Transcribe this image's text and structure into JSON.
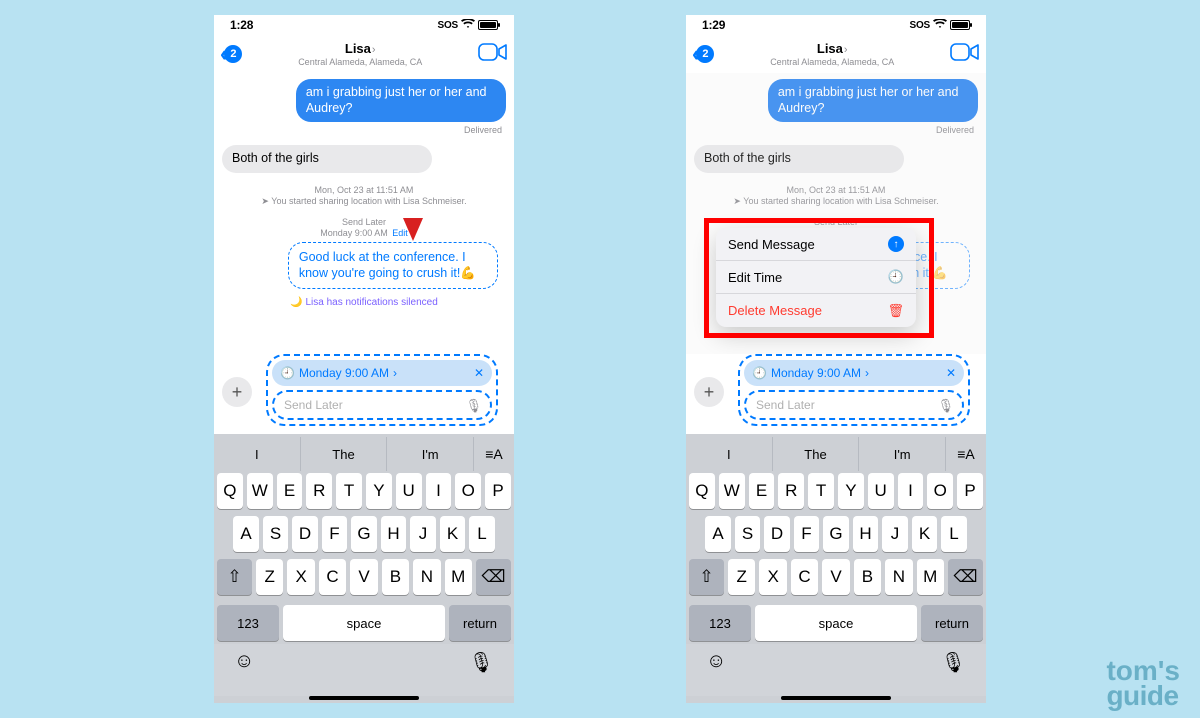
{
  "statusbar": {
    "time_left": "1:28",
    "time_right": "1:29",
    "sos": "SOS"
  },
  "nav": {
    "back_badge": "2",
    "title": "Lisa",
    "subtitle": "Central Alameda, Alameda, CA"
  },
  "conv": {
    "outgoing_msg": "am i grabbing just her or her and Audrey?",
    "delivered": "Delivered",
    "incoming_msg": "Both of the girls",
    "timestamp1": "Mon, Oct 23 at 11:51 AM",
    "location_share": "You started sharing location with Lisa Schmeiser.",
    "send_later_header": "Send Later",
    "schedule_line": "Monday 9:00 AM",
    "edit_link": "Edit",
    "scheduled_msg": "Good luck at the conference. I know you're going to crush it!💪",
    "silenced": "Lisa has notifications silenced"
  },
  "input": {
    "chip_label": "Monday 9:00 AM",
    "placeholder": "Send Later",
    "chip_label_obscured": "Monday 9:00 AM"
  },
  "ctx_menu": {
    "send": "Send Message",
    "edit_time": "Edit Time",
    "delete": "Delete Message"
  },
  "keyboard": {
    "suggestions": [
      "I",
      "The",
      "I'm"
    ],
    "row1": [
      "Q",
      "W",
      "E",
      "R",
      "T",
      "Y",
      "U",
      "I",
      "O",
      "P"
    ],
    "row2": [
      "A",
      "S",
      "D",
      "F",
      "G",
      "H",
      "J",
      "K",
      "L"
    ],
    "row3": [
      "Z",
      "X",
      "C",
      "V",
      "B",
      "N",
      "M"
    ],
    "n123": "123",
    "space": "space",
    "return": "return"
  },
  "watermark": {
    "l1": "tom's",
    "l2": "guide"
  }
}
